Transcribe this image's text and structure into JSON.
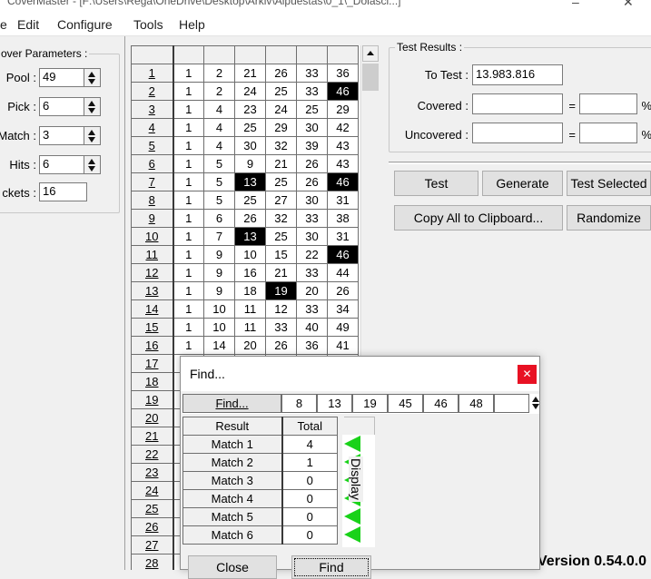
{
  "window": {
    "title": "CoverMaster - [F:\\Users\\Rega\\OneDrive\\Desktop\\Arkiv\\Alpuestas\\0_1\\_Dolasci...]",
    "controls": [
      "–",
      "☐",
      "✕"
    ]
  },
  "menu": {
    "items": [
      "e",
      "Edit",
      "Configure",
      "Tools",
      "Help"
    ]
  },
  "params": {
    "group_title": "over Parameters :",
    "pool": {
      "label": "Pool :",
      "value": "49"
    },
    "pick": {
      "label": "Pick :",
      "value": "6"
    },
    "match": {
      "label": "Match :",
      "value": "3"
    },
    "hits": {
      "label": "Hits :",
      "value": "6"
    },
    "tickets": {
      "label": "ckets :",
      "value": "16"
    }
  },
  "grid": {
    "highlight_color": "#000000",
    "rows": [
      {
        "n": "1",
        "v": [
          "1",
          "2",
          "21",
          "26",
          "33",
          "36"
        ],
        "hl": []
      },
      {
        "n": "2",
        "v": [
          "1",
          "2",
          "24",
          "25",
          "33",
          "46"
        ],
        "hl": [
          5
        ]
      },
      {
        "n": "3",
        "v": [
          "1",
          "4",
          "23",
          "24",
          "25",
          "29"
        ],
        "hl": []
      },
      {
        "n": "4",
        "v": [
          "1",
          "4",
          "25",
          "29",
          "30",
          "42"
        ],
        "hl": []
      },
      {
        "n": "5",
        "v": [
          "1",
          "4",
          "30",
          "32",
          "39",
          "43"
        ],
        "hl": []
      },
      {
        "n": "6",
        "v": [
          "1",
          "5",
          "9",
          "21",
          "26",
          "43"
        ],
        "hl": []
      },
      {
        "n": "7",
        "v": [
          "1",
          "5",
          "13",
          "25",
          "26",
          "46"
        ],
        "hl": [
          2,
          5
        ]
      },
      {
        "n": "8",
        "v": [
          "1",
          "5",
          "25",
          "27",
          "30",
          "31"
        ],
        "hl": []
      },
      {
        "n": "9",
        "v": [
          "1",
          "6",
          "26",
          "32",
          "33",
          "38"
        ],
        "hl": []
      },
      {
        "n": "10",
        "v": [
          "1",
          "7",
          "13",
          "25",
          "30",
          "31"
        ],
        "hl": [
          2
        ]
      },
      {
        "n": "11",
        "v": [
          "1",
          "9",
          "10",
          "15",
          "22",
          "46"
        ],
        "hl": [
          5
        ]
      },
      {
        "n": "12",
        "v": [
          "1",
          "9",
          "16",
          "21",
          "33",
          "44"
        ],
        "hl": []
      },
      {
        "n": "13",
        "v": [
          "1",
          "9",
          "18",
          "19",
          "20",
          "26"
        ],
        "hl": [
          3
        ]
      },
      {
        "n": "14",
        "v": [
          "1",
          "10",
          "11",
          "12",
          "33",
          "34"
        ],
        "hl": []
      },
      {
        "n": "15",
        "v": [
          "1",
          "10",
          "11",
          "33",
          "40",
          "49"
        ],
        "hl": []
      },
      {
        "n": "16",
        "v": [
          "1",
          "14",
          "20",
          "26",
          "36",
          "41"
        ],
        "hl": []
      },
      {
        "n": "17",
        "v": [
          "",
          "",
          "",
          "",
          "",
          ""
        ],
        "hl": []
      },
      {
        "n": "18",
        "v": [
          "",
          "",
          "",
          "",
          "",
          ""
        ],
        "hl": []
      },
      {
        "n": "19",
        "v": [
          "",
          "",
          "",
          "",
          "",
          ""
        ],
        "hl": []
      },
      {
        "n": "20",
        "v": [
          "",
          "",
          "",
          "",
          "",
          ""
        ],
        "hl": []
      },
      {
        "n": "21",
        "v": [
          "",
          "",
          "",
          "",
          "",
          ""
        ],
        "hl": []
      },
      {
        "n": "22",
        "v": [
          "",
          "",
          "",
          "",
          "",
          ""
        ],
        "hl": []
      },
      {
        "n": "23",
        "v": [
          "",
          "",
          "",
          "",
          "",
          ""
        ],
        "hl": []
      },
      {
        "n": "24",
        "v": [
          "",
          "",
          "",
          "",
          "",
          ""
        ],
        "hl": []
      },
      {
        "n": "25",
        "v": [
          "",
          "",
          "",
          "",
          "",
          ""
        ],
        "hl": []
      },
      {
        "n": "26",
        "v": [
          "",
          "",
          "",
          "",
          "",
          ""
        ],
        "hl": []
      },
      {
        "n": "27",
        "v": [
          "",
          "",
          "",
          "",
          "",
          ""
        ],
        "hl": []
      },
      {
        "n": "28",
        "v": [
          "",
          "",
          "",
          "",
          "",
          ""
        ],
        "hl": []
      }
    ]
  },
  "results": {
    "group_title": "Test Results :",
    "to_test": {
      "label": "To Test :",
      "value": "13.983.816"
    },
    "covered": {
      "label": "Covered :",
      "value": "",
      "eq": "=",
      "pct": "",
      "unit": "%"
    },
    "uncovered": {
      "label": "Uncovered :",
      "value": "",
      "eq": "=",
      "pct": "",
      "unit": "%"
    }
  },
  "buttons": {
    "test": "Test",
    "generate": "Generate",
    "test_selected": "Test Selected",
    "copy_all": "Copy All to Clipboard...",
    "randomize": "Randomize"
  },
  "version": "Version 0.54.0.0",
  "find_dialog": {
    "title": "Find...",
    "close_glyph": "✕",
    "find_button": "Find...",
    "numbers": [
      "8",
      "13",
      "19",
      "45",
      "46",
      "48"
    ],
    "col_result": "Result",
    "col_total": "Total",
    "matches": [
      {
        "label": "Match 1",
        "total": "4"
      },
      {
        "label": "Match 2",
        "total": "1"
      },
      {
        "label": "Match 3",
        "total": "0"
      },
      {
        "label": "Match 4",
        "total": "0"
      },
      {
        "label": "Match 5",
        "total": "0"
      },
      {
        "label": "Match 6",
        "total": "0"
      }
    ],
    "display_label": "Display",
    "triangle_color": "#19d219",
    "close_button": "Close",
    "find_action": "Find"
  }
}
